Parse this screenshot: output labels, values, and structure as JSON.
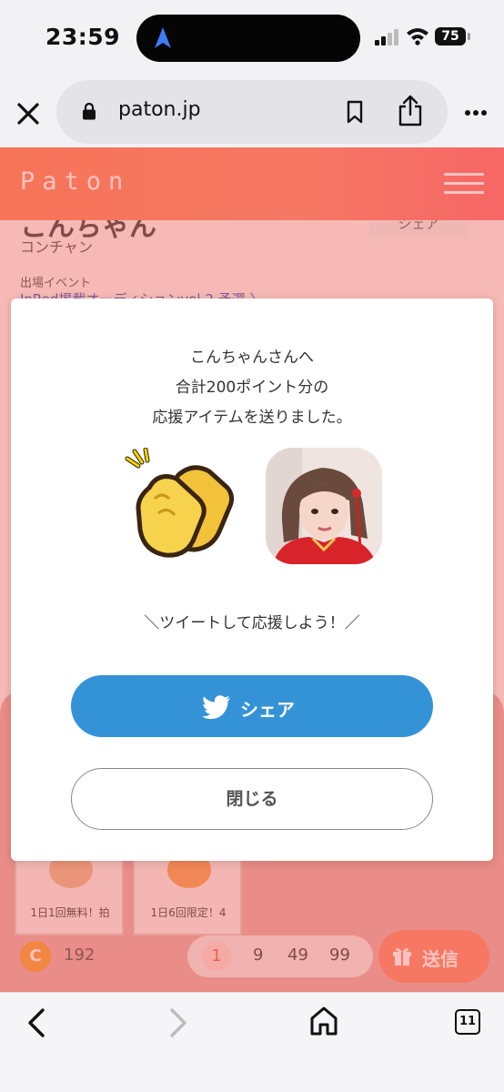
{
  "status_bar": {
    "time": "23:59",
    "battery": "75"
  },
  "browser": {
    "url": "paton.jp",
    "tab_count": "11"
  },
  "site": {
    "logo": "Paton"
  },
  "profile": {
    "name": "こんちゃん",
    "kana": "コンチャン",
    "share_label": "シェア",
    "event_label": "出場イベント",
    "event_name": "InRed掲載オーディションvol.2 予選 〉"
  },
  "modal": {
    "message_lines": [
      "こんちゃんさんへ",
      "合計200ポイント分の",
      "応援アイテムを送りました。"
    ],
    "tweet_prompt": "＼ツイートして応援しよう！／",
    "share_button": "シェア",
    "close_button": "閉じる"
  },
  "items": [
    {
      "caption": "1日1回無料！拍"
    },
    {
      "caption": "1日6回限定！4"
    }
  ],
  "wallet": {
    "coin_symbol": "C",
    "balance": "192",
    "amounts": [
      "1",
      "9",
      "49",
      "99"
    ],
    "selected_amount": "1",
    "send_label": "送信"
  },
  "colors": {
    "header_start": "#f9845c",
    "header_end": "#f96f72",
    "twitter_blue": "#3493d6",
    "send_orange": "#f98a6e"
  },
  "icons": [
    "navigation-arrow-icon",
    "signal-icon",
    "wifi-icon",
    "close-icon",
    "lock-icon",
    "bookmark-icon",
    "share-icon",
    "more-icon",
    "hamburger-icon",
    "clap-icon",
    "twitter-icon",
    "gift-icon",
    "back-icon",
    "forward-icon",
    "home-icon"
  ]
}
